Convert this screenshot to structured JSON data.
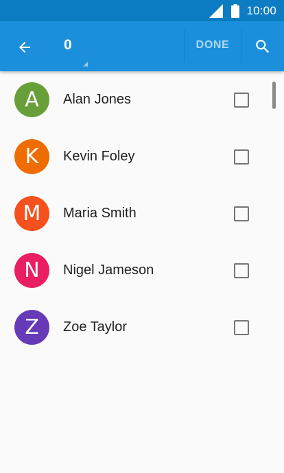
{
  "status_bar": {
    "time": "10:00",
    "icons": [
      "signal-icon",
      "battery-icon"
    ]
  },
  "app_bar": {
    "color": "#1b8fdc",
    "selected_count": "0",
    "done_label": "DONE",
    "icons": [
      "arrow-back-icon",
      "search-icon"
    ]
  },
  "contacts": [
    {
      "initial": "A",
      "name": "Alan Jones",
      "color": "#689f38",
      "checked": false
    },
    {
      "initial": "K",
      "name": "Kevin Foley",
      "color": "#ef6c00",
      "checked": false
    },
    {
      "initial": "M",
      "name": "Maria Smith",
      "color": "#f4511e",
      "checked": false
    },
    {
      "initial": "N",
      "name": "Nigel Jameson",
      "color": "#e91e63",
      "checked": false
    },
    {
      "initial": "Z",
      "name": "Zoe Taylor",
      "color": "#673ab7",
      "checked": false
    }
  ]
}
